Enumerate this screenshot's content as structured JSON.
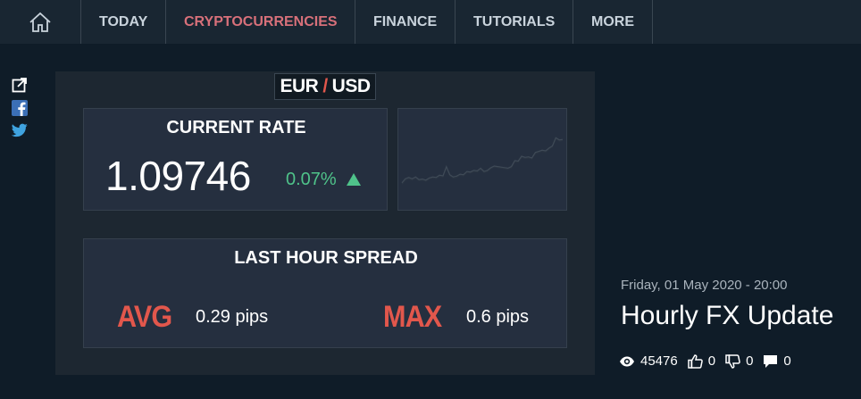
{
  "nav": {
    "home_icon": "home-icon",
    "items": [
      {
        "label": "TODAY",
        "active": false
      },
      {
        "label": "CRYPTOCURRENCIES",
        "active": true
      },
      {
        "label": "FINANCE",
        "active": false
      },
      {
        "label": "TUTORIALS",
        "active": false
      },
      {
        "label": "MORE",
        "active": false
      }
    ]
  },
  "social": [
    "external-link-icon",
    "facebook-icon",
    "twitter-icon"
  ],
  "card": {
    "pair_base": "EUR",
    "pair_sep": "/",
    "pair_quote": "USD",
    "current_rate_title": "CURRENT RATE",
    "rate": "1.09746",
    "change": "0.07%",
    "change_direction": "up",
    "spread_title": "LAST HOUR SPREAD",
    "avg_label": "AVG",
    "avg_value": "0.29 pips",
    "max_label": "MAX",
    "max_value": "0.6 pips"
  },
  "colors": {
    "accent_red": "#e2574c",
    "active_nav": "#d8707a",
    "positive": "#4fc38a",
    "background": "#0f1c28"
  },
  "chart_data": {
    "type": "line",
    "title": "",
    "xlabel": "",
    "ylabel": "",
    "values": [
      0,
      1.5,
      2,
      1.5,
      2.2,
      1.2,
      1.4,
      1.0,
      1.8,
      2.2,
      2.0,
      2.8,
      2.6,
      6.0,
      3.0,
      2.2,
      2.5,
      3.2,
      3.0,
      4.2,
      4.0,
      4.6,
      4.4,
      5.4,
      4.2,
      4.6,
      5.6,
      6.2,
      6.0,
      5.8,
      5.6,
      5.4,
      6.0,
      8.2,
      8.0,
      9.8,
      9.4,
      9.6,
      9.2,
      11.2,
      11.6,
      12.0,
      11.8,
      12.8,
      13.6,
      16.6,
      15.8,
      16.0
    ],
    "values_b": [
      -0.5,
      1.0,
      1.5,
      1.0,
      1.7,
      0.8,
      1.0,
      0.6,
      1.4,
      1.8,
      1.6,
      2.4,
      2.2,
      5.4,
      2.6,
      1.8,
      2.0,
      2.8,
      2.6,
      3.8,
      3.6,
      4.2,
      4.0,
      5.0,
      3.8,
      4.2,
      5.2,
      5.8,
      5.6,
      5.4,
      5.2,
      5.0,
      5.6,
      7.8,
      7.6,
      9.4,
      9.0,
      9.2,
      8.8,
      10.8,
      11.2,
      11.6,
      11.4,
      12.4,
      13.2,
      16.2,
      15.4,
      15.6
    ],
    "ylim": [
      -3,
      20
    ],
    "grid": false
  },
  "meta": {
    "date": "Friday, 01 May 2020 - 20:00",
    "title": "Hourly FX Update",
    "views": "45476",
    "likes": "0",
    "dislikes": "0",
    "comments": "0"
  }
}
